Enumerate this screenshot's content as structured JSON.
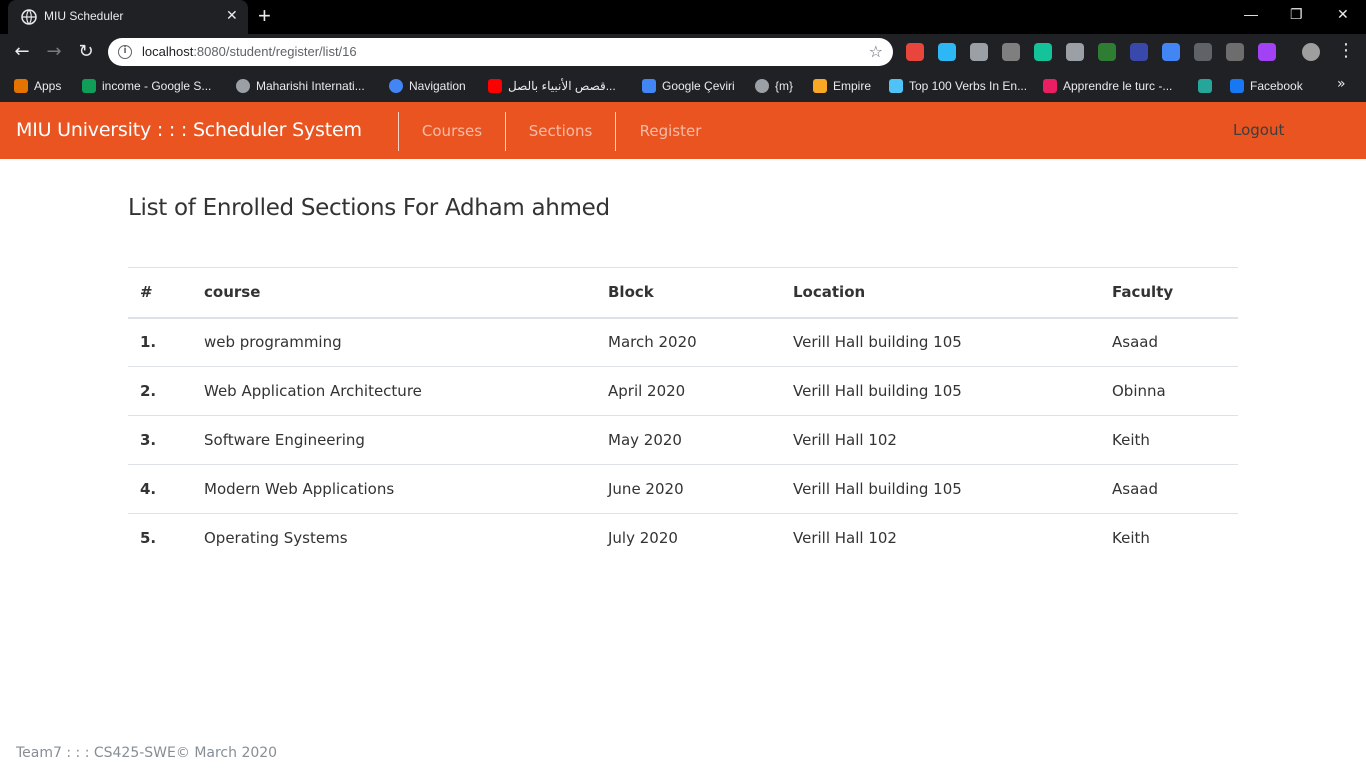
{
  "browser": {
    "tab_title": "MIU Scheduler",
    "new_tab": "+",
    "url_host": "localhost",
    "url_path": ":8080/student/register/list/16",
    "extension_colors": [
      "#e8453c",
      "#2db7f5",
      "#9aa0a6",
      "#7f7f7f",
      "#15c39a",
      "#9aa0a6",
      "#2e7d32",
      "#3949ab",
      "#4285f4",
      "#5f6368",
      "#6d6d6d",
      "#a142f4",
      "#9e9e9e"
    ],
    "bookmarks": [
      {
        "label": "Apps",
        "icon": "apps-grid-icon",
        "color": "#e37400"
      },
      {
        "label": "income - Google S...",
        "icon": "google-sheets-icon",
        "color": "#0f9d58"
      },
      {
        "label": "Maharishi Internati...",
        "icon": "globe-icon",
        "color": "#9aa0a6"
      },
      {
        "label": "Navigation",
        "icon": "navigation-icon",
        "color": "#4285f4"
      },
      {
        "label": "قصص الأنبياء بالصل...",
        "icon": "youtube-icon",
        "color": "#ff0000"
      },
      {
        "label": "Google Çeviri",
        "icon": "google-translate-icon",
        "color": "#4285f4"
      },
      {
        "label": "{m}",
        "icon": "globe-icon",
        "color": "#9aa0a6"
      },
      {
        "label": "Empire",
        "icon": "empire-icon",
        "color": "#f9a825"
      },
      {
        "label": "Top 100 Verbs In En...",
        "icon": "verbs-icon",
        "color": "#4fc3f7"
      },
      {
        "label": "Apprendre le turc -...",
        "icon": "turc-icon",
        "color": "#e91e63"
      },
      {
        "label": "",
        "icon": "bird-icon",
        "color": "#26a69a"
      },
      {
        "label": "Facebook",
        "icon": "facebook-icon",
        "color": "#1877f2"
      }
    ],
    "more": "»"
  },
  "navbar": {
    "brand": "MIU University : : : Scheduler System",
    "links": [
      "Courses",
      "Sections",
      "Register"
    ],
    "logout": "Logout",
    "accent": "#e95420"
  },
  "page": {
    "heading": "List of Enrolled Sections For Adham ahmed"
  },
  "table": {
    "headers": [
      "#",
      "course",
      "Block",
      "Location",
      "Faculty"
    ],
    "rows": [
      {
        "num": "1.",
        "course": "web programming",
        "block": "March 2020",
        "location": "Verill Hall building 105",
        "faculty": "Asaad"
      },
      {
        "num": "2.",
        "course": "Web Application Architecture",
        "block": "April 2020",
        "location": "Verill Hall building 105",
        "faculty": "Obinna"
      },
      {
        "num": "3.",
        "course": "Software Engineering",
        "block": "May 2020",
        "location": "Verill Hall 102",
        "faculty": "Keith"
      },
      {
        "num": "4.",
        "course": "Modern Web Applications",
        "block": "June 2020",
        "location": "Verill Hall building 105",
        "faculty": "Asaad"
      },
      {
        "num": "5.",
        "course": "Operating Systems",
        "block": "July 2020",
        "location": "Verill Hall 102",
        "faculty": "Keith"
      }
    ]
  },
  "footer": "Team7 : : : CS425-SWE© March 2020"
}
